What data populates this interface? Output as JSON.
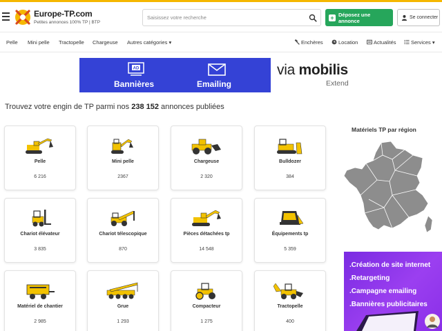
{
  "brand": {
    "name": "Europe-TP.com",
    "tagline": "Petites annonces 100% TP | BTP"
  },
  "search": {
    "placeholder": "Saisissez votre recherche"
  },
  "actions": {
    "post_label": "Déposez une annonce",
    "login_label": "Se connecter"
  },
  "nav": {
    "left": [
      "Pelle",
      "Mini pelle",
      "Tractopelle",
      "Chargeuse",
      "Autres catégories"
    ],
    "right": [
      {
        "label": "Enchères",
        "icon": "gavel-icon"
      },
      {
        "label": "Location",
        "icon": "clock-icon"
      },
      {
        "label": "Actualités",
        "icon": "newspaper-icon"
      },
      {
        "label": "Services",
        "icon": "list-icon"
      }
    ]
  },
  "banner": {
    "label1": "Bannières",
    "label2": "Emailing",
    "brand_via": "via",
    "brand_name": "mobilis",
    "brand_sub": "Extend"
  },
  "headline": {
    "prefix": "Trouvez votre engin de TP parmi nos ",
    "count": "238 152",
    "suffix": " annonces publiées"
  },
  "categories": [
    {
      "title": "Pelle",
      "count": "6 216",
      "icon": "excavator-icon"
    },
    {
      "title": "Mini pelle",
      "count": "2367",
      "icon": "mini-excavator-icon"
    },
    {
      "title": "Chargeuse",
      "count": "2 320",
      "icon": "loader-icon"
    },
    {
      "title": "Bulldozer",
      "count": "384",
      "icon": "bulldozer-icon"
    },
    {
      "title": "Chariot élévateur",
      "count": "3 835",
      "icon": "forklift-icon"
    },
    {
      "title": "Chariot télescopique",
      "count": "870",
      "icon": "telehandler-icon"
    },
    {
      "title": "Pièces détachées tp",
      "count": "14 548",
      "icon": "excavator-parts-icon"
    },
    {
      "title": "Équipements tp",
      "count": "5 359",
      "icon": "equipment-icon"
    },
    {
      "title": "Matériel de chantier",
      "count": "2 985",
      "icon": "compressor-icon"
    },
    {
      "title": "Grue",
      "count": "1 293",
      "icon": "crane-icon"
    },
    {
      "title": "Compacteur",
      "count": "1 275",
      "icon": "compactor-icon"
    },
    {
      "title": "Tractopelle",
      "count": "400",
      "icon": "backhoe-icon"
    }
  ],
  "sidebar": {
    "region_title": "Matériels TP par région"
  },
  "ad": {
    "lines": [
      ".Création de site internet",
      ".Retargeting",
      ".Campagne emailing",
      ".Bannières publicitaires"
    ]
  },
  "colors": {
    "accent_yellow": "#f5b700",
    "green": "#26a65b",
    "banner_blue": "#3442d6",
    "ad_purple": "#8a2fe8",
    "map_gray": "#8d8d8d"
  }
}
